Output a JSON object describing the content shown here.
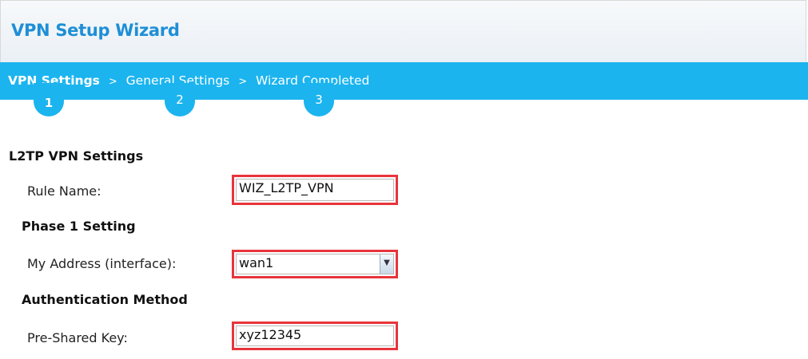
{
  "window": {
    "title": "VPN Setup Wizard"
  },
  "steps": [
    {
      "label": "VPN Settings",
      "number": "1",
      "active": true
    },
    {
      "label": "General Settings",
      "number": "2",
      "active": false
    },
    {
      "label": "Wizard Completed",
      "number": "3",
      "active": false
    }
  ],
  "step_separator": ">",
  "form": {
    "section_title": "L2TP VPN Settings",
    "rule_name": {
      "label": "Rule Name:",
      "value": "WIZ_L2TP_VPN"
    },
    "phase1": {
      "heading": "Phase 1 Setting",
      "my_address": {
        "label": "My Address (interface):",
        "value": "wan1"
      }
    },
    "auth": {
      "heading": "Authentication Method",
      "psk": {
        "label": "Pre-Shared Key:",
        "value": "xyz12345"
      }
    }
  },
  "colors": {
    "accent": "#1bb4ef",
    "title": "#1e8fd6",
    "highlight": "#e8343b"
  },
  "icons": {
    "dropdown": "chevron-down-icon"
  }
}
